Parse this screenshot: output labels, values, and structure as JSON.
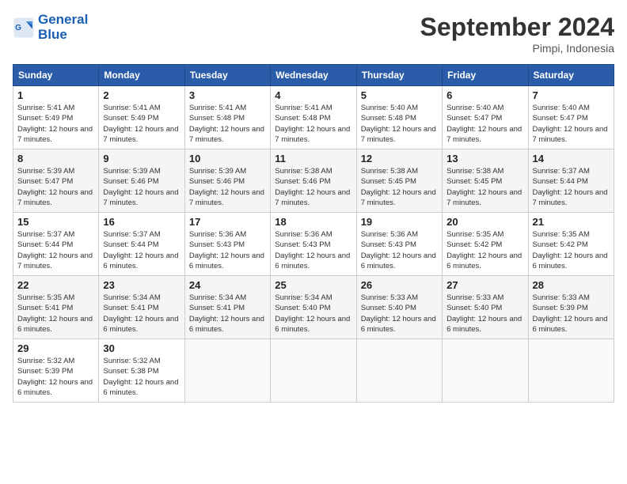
{
  "header": {
    "logo_line1": "General",
    "logo_line2": "Blue",
    "month": "September 2024",
    "location": "Pimpi, Indonesia"
  },
  "weekdays": [
    "Sunday",
    "Monday",
    "Tuesday",
    "Wednesday",
    "Thursday",
    "Friday",
    "Saturday"
  ],
  "weeks": [
    [
      {
        "day": "1",
        "sunrise": "5:41 AM",
        "sunset": "5:49 PM",
        "daylight": "12 hours and 7 minutes."
      },
      {
        "day": "2",
        "sunrise": "5:41 AM",
        "sunset": "5:49 PM",
        "daylight": "12 hours and 7 minutes."
      },
      {
        "day": "3",
        "sunrise": "5:41 AM",
        "sunset": "5:48 PM",
        "daylight": "12 hours and 7 minutes."
      },
      {
        "day": "4",
        "sunrise": "5:41 AM",
        "sunset": "5:48 PM",
        "daylight": "12 hours and 7 minutes."
      },
      {
        "day": "5",
        "sunrise": "5:40 AM",
        "sunset": "5:48 PM",
        "daylight": "12 hours and 7 minutes."
      },
      {
        "day": "6",
        "sunrise": "5:40 AM",
        "sunset": "5:47 PM",
        "daylight": "12 hours and 7 minutes."
      },
      {
        "day": "7",
        "sunrise": "5:40 AM",
        "sunset": "5:47 PM",
        "daylight": "12 hours and 7 minutes."
      }
    ],
    [
      {
        "day": "8",
        "sunrise": "5:39 AM",
        "sunset": "5:47 PM",
        "daylight": "12 hours and 7 minutes."
      },
      {
        "day": "9",
        "sunrise": "5:39 AM",
        "sunset": "5:46 PM",
        "daylight": "12 hours and 7 minutes."
      },
      {
        "day": "10",
        "sunrise": "5:39 AM",
        "sunset": "5:46 PM",
        "daylight": "12 hours and 7 minutes."
      },
      {
        "day": "11",
        "sunrise": "5:38 AM",
        "sunset": "5:46 PM",
        "daylight": "12 hours and 7 minutes."
      },
      {
        "day": "12",
        "sunrise": "5:38 AM",
        "sunset": "5:45 PM",
        "daylight": "12 hours and 7 minutes."
      },
      {
        "day": "13",
        "sunrise": "5:38 AM",
        "sunset": "5:45 PM",
        "daylight": "12 hours and 7 minutes."
      },
      {
        "day": "14",
        "sunrise": "5:37 AM",
        "sunset": "5:44 PM",
        "daylight": "12 hours and 7 minutes."
      }
    ],
    [
      {
        "day": "15",
        "sunrise": "5:37 AM",
        "sunset": "5:44 PM",
        "daylight": "12 hours and 7 minutes."
      },
      {
        "day": "16",
        "sunrise": "5:37 AM",
        "sunset": "5:44 PM",
        "daylight": "12 hours and 6 minutes."
      },
      {
        "day": "17",
        "sunrise": "5:36 AM",
        "sunset": "5:43 PM",
        "daylight": "12 hours and 6 minutes."
      },
      {
        "day": "18",
        "sunrise": "5:36 AM",
        "sunset": "5:43 PM",
        "daylight": "12 hours and 6 minutes."
      },
      {
        "day": "19",
        "sunrise": "5:36 AM",
        "sunset": "5:43 PM",
        "daylight": "12 hours and 6 minutes."
      },
      {
        "day": "20",
        "sunrise": "5:35 AM",
        "sunset": "5:42 PM",
        "daylight": "12 hours and 6 minutes."
      },
      {
        "day": "21",
        "sunrise": "5:35 AM",
        "sunset": "5:42 PM",
        "daylight": "12 hours and 6 minutes."
      }
    ],
    [
      {
        "day": "22",
        "sunrise": "5:35 AM",
        "sunset": "5:41 PM",
        "daylight": "12 hours and 6 minutes."
      },
      {
        "day": "23",
        "sunrise": "5:34 AM",
        "sunset": "5:41 PM",
        "daylight": "12 hours and 6 minutes."
      },
      {
        "day": "24",
        "sunrise": "5:34 AM",
        "sunset": "5:41 PM",
        "daylight": "12 hours and 6 minutes."
      },
      {
        "day": "25",
        "sunrise": "5:34 AM",
        "sunset": "5:40 PM",
        "daylight": "12 hours and 6 minutes."
      },
      {
        "day": "26",
        "sunrise": "5:33 AM",
        "sunset": "5:40 PM",
        "daylight": "12 hours and 6 minutes."
      },
      {
        "day": "27",
        "sunrise": "5:33 AM",
        "sunset": "5:40 PM",
        "daylight": "12 hours and 6 minutes."
      },
      {
        "day": "28",
        "sunrise": "5:33 AM",
        "sunset": "5:39 PM",
        "daylight": "12 hours and 6 minutes."
      }
    ],
    [
      {
        "day": "29",
        "sunrise": "5:32 AM",
        "sunset": "5:39 PM",
        "daylight": "12 hours and 6 minutes."
      },
      {
        "day": "30",
        "sunrise": "5:32 AM",
        "sunset": "5:38 PM",
        "daylight": "12 hours and 6 minutes."
      },
      null,
      null,
      null,
      null,
      null
    ]
  ]
}
